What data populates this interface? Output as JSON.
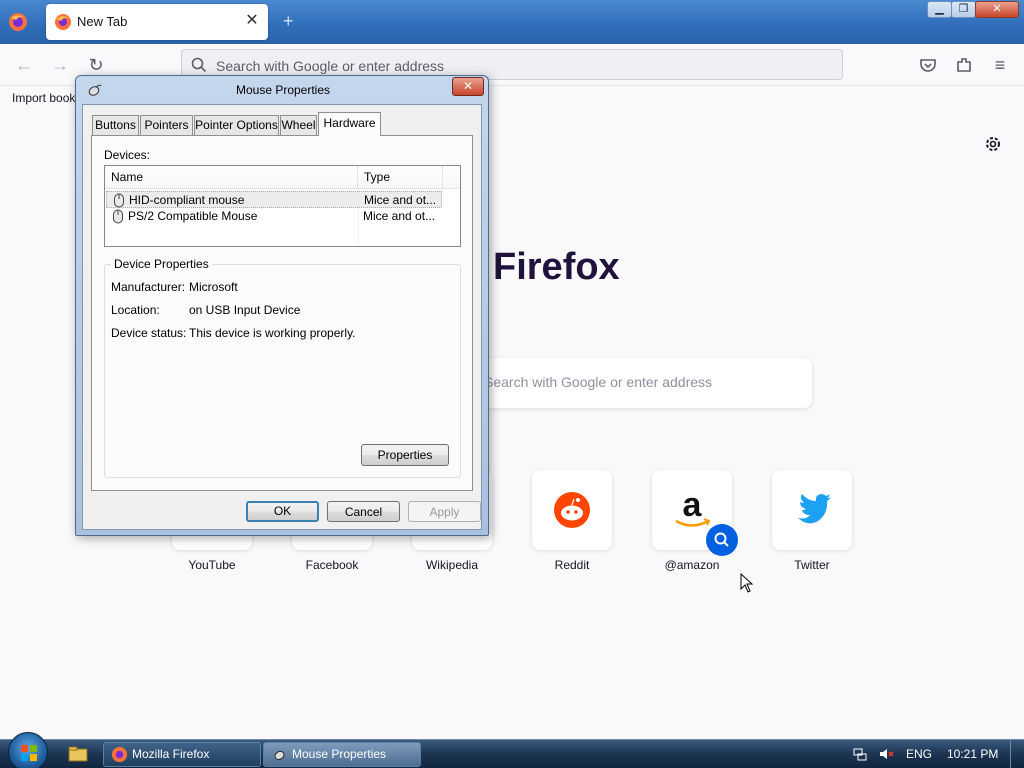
{
  "browser": {
    "tab_title": "New Tab",
    "tab_close": "✕",
    "new_tab": "+",
    "url_placeholder": "Search with Google or enter address",
    "bookmark_import": "Import bookmarks...",
    "brand": "Firefox",
    "search_placeholder": "Search with Google or enter address",
    "top_sites": [
      {
        "name": "YouTube"
      },
      {
        "name": "Facebook"
      },
      {
        "name": "Wikipedia"
      },
      {
        "name": "Reddit"
      },
      {
        "name": "@amazon"
      },
      {
        "name": "Twitter"
      }
    ]
  },
  "dialog": {
    "title": "Mouse Properties",
    "close": "✕",
    "tabs": [
      "Buttons",
      "Pointers",
      "Pointer Options",
      "Wheel",
      "Hardware"
    ],
    "active_tab": "Hardware",
    "devices_label": "Devices:",
    "columns": [
      "Name",
      "Type"
    ],
    "devices": [
      {
        "name": "HID-compliant mouse",
        "type": "Mice and ot..."
      },
      {
        "name": "PS/2 Compatible Mouse",
        "type": "Mice and ot..."
      }
    ],
    "device_properties_label": "Device Properties",
    "properties": [
      {
        "key": "Manufacturer:",
        "value": "Microsoft"
      },
      {
        "key": "Location:",
        "value": "on USB Input Device"
      },
      {
        "key": "Device status:",
        "value": "This device is working properly."
      }
    ],
    "properties_button": "Properties",
    "ok": "OK",
    "cancel": "Cancel",
    "apply": "Apply"
  },
  "taskbar": {
    "tasks": [
      {
        "label": "Mozilla Firefox"
      },
      {
        "label": "Mouse Properties"
      }
    ],
    "language": "ENG",
    "clock": "10:21 PM"
  },
  "colors": {
    "titlebar": "#2f6db9",
    "firefox_brand_text": "#20123a",
    "reddit_orange": "#ff4500",
    "twitter_blue": "#1da1f2",
    "amazon_orange": "#ff9900",
    "search_badge_blue": "#0060df"
  }
}
